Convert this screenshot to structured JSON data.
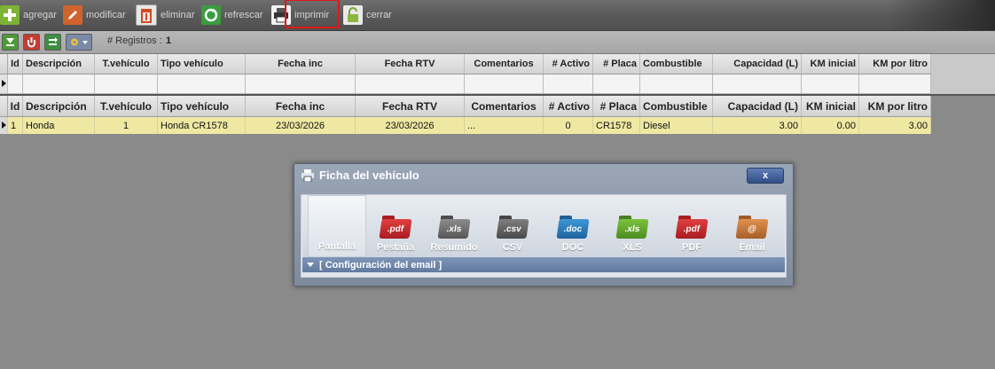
{
  "toolbar": {
    "buttons": [
      {
        "label": "agregar",
        "icon": "add-icon"
      },
      {
        "label": "modificar",
        "icon": "pencil-icon"
      },
      {
        "label": "eliminar",
        "icon": "trash-icon"
      },
      {
        "label": "refrescar",
        "icon": "refresh-icon"
      },
      {
        "label": "imprimir",
        "icon": "printer-icon"
      },
      {
        "label": "cerrar",
        "icon": "lock-icon"
      }
    ]
  },
  "subbar": {
    "icons": [
      "download-icon",
      "upload-icon",
      "swap-icon",
      "settings-icon"
    ],
    "records_label": "# Registros :",
    "records_count": "1"
  },
  "grid": {
    "columns": [
      "Id",
      "Descripción",
      "T.vehículo",
      "Tipo vehículo",
      "Fecha inc",
      "Fecha RTV",
      "Comentarios",
      "# Activo",
      "# Placa",
      "Combustible",
      "Capacidad (L)",
      "KM inicial",
      "KM por litro"
    ],
    "rows": [
      [
        "1",
        "Honda",
        "1",
        "Honda CR1578",
        "23/03/2026",
        "23/03/2026",
        "...",
        "0",
        "CR1578",
        "Diesel",
        "3.00",
        "0.00",
        "3.00"
      ]
    ]
  },
  "dialog": {
    "title": "Ficha del vehículo",
    "close_label": "x",
    "export_options": [
      {
        "label": "Pantalla",
        "icon": "screen-icon",
        "badge": ""
      },
      {
        "label": "Pestaña",
        "icon": "pdf-folder-icon",
        "badge": ".pdf",
        "color": "#c9272b"
      },
      {
        "label": "Resumido",
        "icon": "xls-folder-icon",
        "badge": ".xls",
        "color": "#6b6b6b"
      },
      {
        "label": "CSV",
        "icon": "csv-folder-icon",
        "badge": ".csv",
        "color": "#5d5d5d"
      },
      {
        "label": "DOC",
        "icon": "doc-folder-icon",
        "badge": ".doc",
        "color": "#2a79b8"
      },
      {
        "label": "XLS",
        "icon": "xls-folder-icon",
        "badge": ".xls",
        "color": "#5f9f2d"
      },
      {
        "label": "PDF",
        "icon": "pdf-folder-icon",
        "badge": ".pdf",
        "color": "#c9272b"
      },
      {
        "label": "Email",
        "icon": "email-icon",
        "badge": "@",
        "color": "#c8753a"
      }
    ],
    "config_label": "[ Configuración del email ]"
  }
}
